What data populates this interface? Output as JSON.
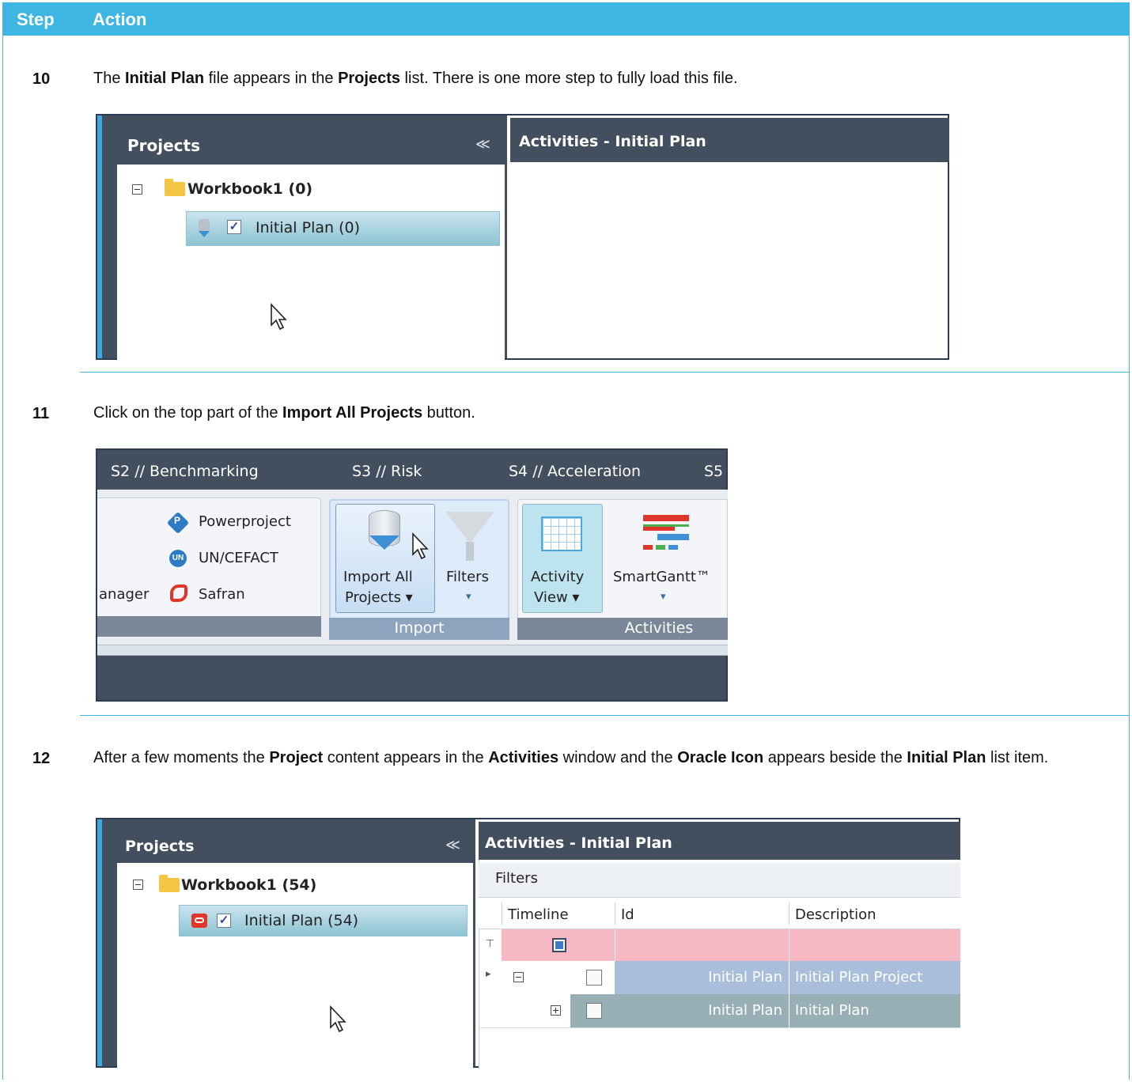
{
  "table": {
    "header": {
      "step": "Step",
      "action": "Action"
    },
    "rows": [
      {
        "step": "10",
        "text": [
          "The ",
          "Initial Plan",
          " file appears in the ",
          "Projects",
          " list. There is one more step to fully load this file."
        ]
      },
      {
        "step": "11",
        "text": [
          "Click on the top part of the ",
          "Import All Projects",
          " button."
        ]
      },
      {
        "step": "12",
        "text": [
          "After a few moments the ",
          "Project",
          " content appears in the ",
          "Activities",
          " window and the ",
          "Oracle Icon",
          " appears beside the ",
          "Initial Plan",
          " list item."
        ]
      }
    ]
  },
  "shot1": {
    "projects_title": "Projects",
    "collapse_glyph": "≪",
    "activities_title": "Activities - Initial  Plan",
    "workbook": "Workbook1 (0)",
    "plan": "Initial  Plan (0)",
    "check": "✓"
  },
  "shot2": {
    "tabs": [
      "S2 // Benchmarking",
      "S3 // Risk",
      "S4 // Acceleration",
      "S5"
    ],
    "left_items": [
      "Powerproject",
      "UN/CEFACT",
      "Safran"
    ],
    "left_cut": "anager",
    "import_all": [
      "Import All",
      "Projects ▾"
    ],
    "filters": "Filters",
    "filters_arrow": "▾",
    "import_group": "Import",
    "activity_view": [
      "Activity",
      "View ▾"
    ],
    "smartgantt": "SmartGantt™",
    "smartgantt_arrow": "▾",
    "activities_group": "Activities",
    "un_badge": "UN",
    "pp_badge": "P"
  },
  "shot3": {
    "projects_title": "Projects",
    "collapse_glyph": "≪",
    "activities_title": "Activities - Initial  Plan",
    "workbook": "Workbook1 (54)",
    "plan": "Initial  Plan (54)",
    "check": "✓",
    "filters": "Filters",
    "columns": [
      "Timeline",
      "Id",
      "Description"
    ],
    "rows": [
      {
        "id": "Initial  Plan",
        "description": "Initial  Plan Project"
      },
      {
        "id": "Initial  Plan",
        "description": "Initial  Plan"
      }
    ],
    "filter_glyph": "⊤",
    "row_arrow": "▸"
  }
}
